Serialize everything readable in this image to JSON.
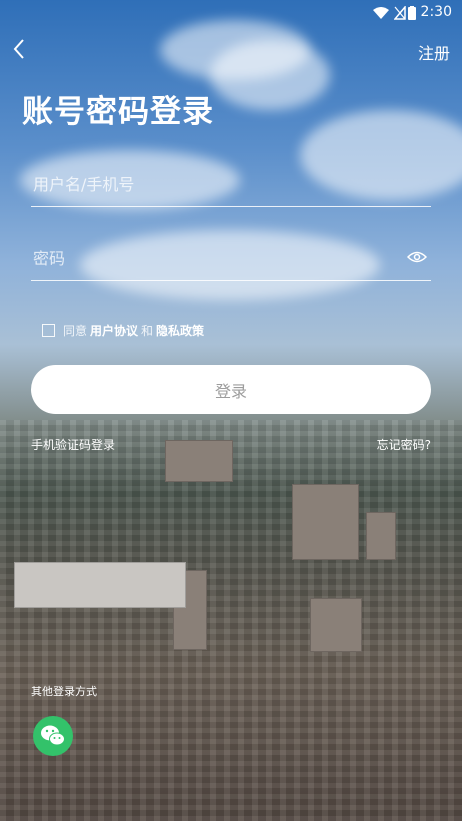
{
  "status_bar": {
    "time": "2:30"
  },
  "nav": {
    "register_label": "注册"
  },
  "page": {
    "title": "账号密码登录"
  },
  "form": {
    "username_placeholder": "用户名/手机号",
    "password_placeholder": "密码",
    "agreement": {
      "prefix": "同意",
      "user_agreement": "用户协议",
      "and": "和",
      "privacy_policy": "隐私政策"
    },
    "login_label": "登录"
  },
  "links": {
    "sms_login": "手机验证码登录",
    "forgot_password": "忘记密码?"
  },
  "other_login": {
    "label": "其他登录方式"
  },
  "colors": {
    "wechat": "#33c26a",
    "button_text": "#9c9c9c"
  }
}
